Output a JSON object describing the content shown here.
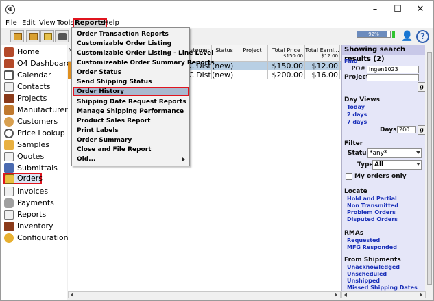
{
  "window": {
    "minimize": "–",
    "maximize": "☐",
    "close": "✕"
  },
  "menubar": [
    "File",
    "Edit",
    "View",
    "Tools",
    "Reports",
    "Help"
  ],
  "toolbar": {
    "progress_text": "92%",
    "progress_fraction": 0.92,
    "help": "?"
  },
  "sidebar": [
    "Home",
    "O4 Dashboard",
    "Calendar",
    "Contacts",
    "Projects",
    "Manufacturers",
    "Customers",
    "Price Lookup",
    "Samples",
    "Quotes",
    "Submittals",
    "Orders",
    "Invoices",
    "Payments",
    "Reports",
    "Inventory",
    "Configuration"
  ],
  "table": {
    "columns": [
      {
        "label": "N"
      },
      {
        "label": "stomer"
      },
      {
        "label": "Status"
      },
      {
        "label": "Project"
      },
      {
        "label": "Total Price",
        "sub": "$150.00"
      },
      {
        "label": "Total Earni...",
        "sub": "$12.00"
      }
    ],
    "rows": [
      {
        "customer": "C Dist...",
        "status": "(new)",
        "project": "",
        "price": "$150.00",
        "earnings": "$12.00"
      },
      {
        "customer": "C Dist...",
        "status": "(new)",
        "project": "",
        "price": "$200.00",
        "earnings": "$16.00"
      }
    ]
  },
  "dropdown": {
    "items": [
      "Order Transaction Reports",
      "Customizable Order Listing",
      "Customizable Order Listing - Line Level",
      "Customizeable Order Summary Reports",
      "Order Status",
      "Send Shipping Status",
      "Order History",
      "Shipping Date Request Reports",
      "Manage Shipping Performance",
      "Product Sales Report",
      "Print Labels",
      "Order Summary",
      "Close and File Report",
      "Old..."
    ]
  },
  "panel": {
    "header": "Showing search results (2)",
    "find": "Find",
    "po_label": "PO#",
    "po_value": "ingen1023",
    "project_label": "Project:",
    "go": "g",
    "day_views": "Day Views",
    "today": "Today",
    "two_days": "2 days",
    "seven_days": "7 days",
    "days_label": "Days:",
    "days_value": "200",
    "filter": "Filter",
    "status_label": "Status:",
    "status_value": "*any*",
    "type_label": "Type:",
    "type_value": "All",
    "my_orders": "My orders only",
    "locate": "Locate",
    "locate_links": [
      "Hold and Partial",
      "Non Transmitted",
      "Problem Orders",
      "Disputed Orders"
    ],
    "rmas": "RMAs",
    "rma_links": [
      "Requested",
      "MFG Responded"
    ],
    "from_shipments": "From Shipments",
    "shipment_links": [
      "Unacknowledged",
      "Unscheduled",
      "Unshipped",
      "Missed Shipping Dates"
    ]
  }
}
